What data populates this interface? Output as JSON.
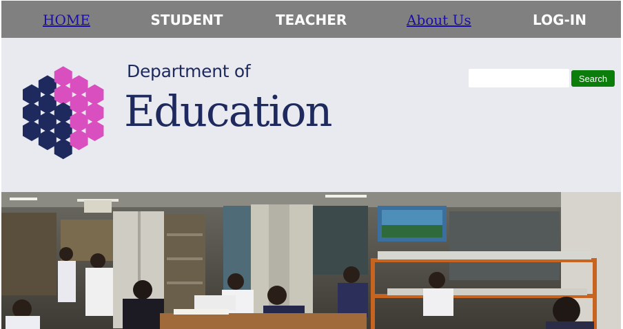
{
  "nav": {
    "items": [
      {
        "label": "HOME",
        "link": true
      },
      {
        "label": "STUDENT",
        "link": false
      },
      {
        "label": "TEACHER",
        "link": false
      },
      {
        "label": "About Us",
        "link": true
      },
      {
        "label": "LOG-IN",
        "link": false
      }
    ]
  },
  "header": {
    "logo_line1": "Department of",
    "logo_line2": "Education"
  },
  "search": {
    "value": "",
    "placeholder": "",
    "button_label": "Search"
  },
  "colors": {
    "nav_background": "#808080",
    "header_background": "#e8eaef",
    "logo_navy": "#1e2a5e",
    "logo_magenta": "#d94fbf",
    "search_button": "#0a7d0a"
  },
  "banner": {
    "description_icon": "library-classroom-photo"
  }
}
